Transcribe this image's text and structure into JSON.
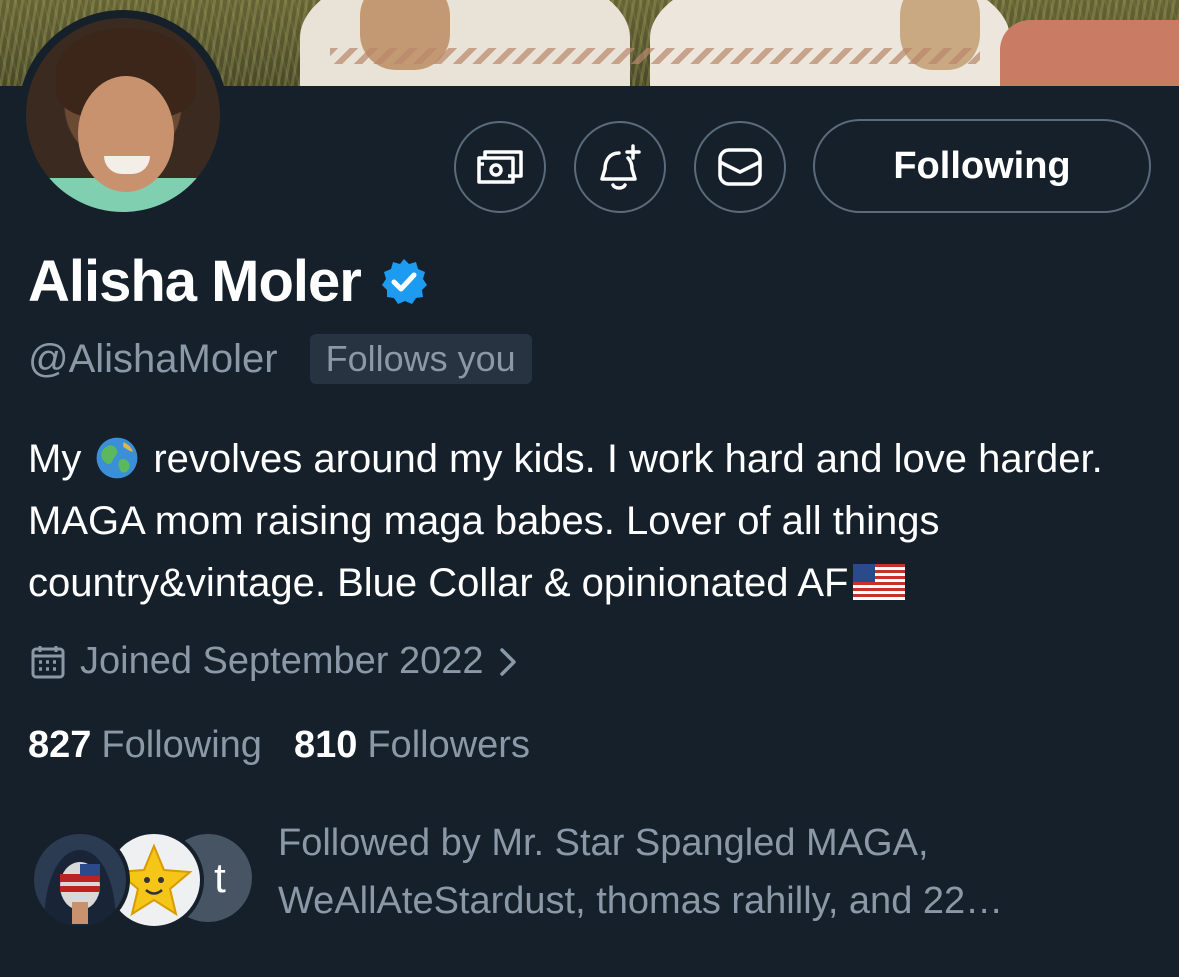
{
  "profile": {
    "name": "Alisha Moler",
    "handle": "@AlishaMoler",
    "follows_you": "Follows you",
    "verified": true,
    "bio_part1": "My",
    "bio_part2": "revolves around my kids. I work hard and love harder. MAGA mom raising maga babes. Lover of all things country&vintage. Blue Collar & opinionated AF",
    "joined": "Joined September 2022",
    "following_count": "827",
    "following_label": "Following",
    "followers_count": "810",
    "followers_label": "Followers",
    "followed_by": "Followed by Mr. Star Spangled MAGA, WeAllAteStardust, thomas rahilly, and 22…",
    "follower_initial": "t"
  },
  "actions": {
    "follow_button_label": "Following"
  },
  "icons": {
    "tip": "money-icon",
    "notify": "bell-plus-icon",
    "message": "envelope-icon",
    "verified": "verified-badge-icon",
    "calendar": "calendar-icon",
    "chevron": "chevron-right-icon"
  },
  "colors": {
    "background": "#15202b",
    "muted_text": "#8b98a5",
    "verified_blue": "#1d9bf0",
    "button_border": "#5b6b7a"
  }
}
